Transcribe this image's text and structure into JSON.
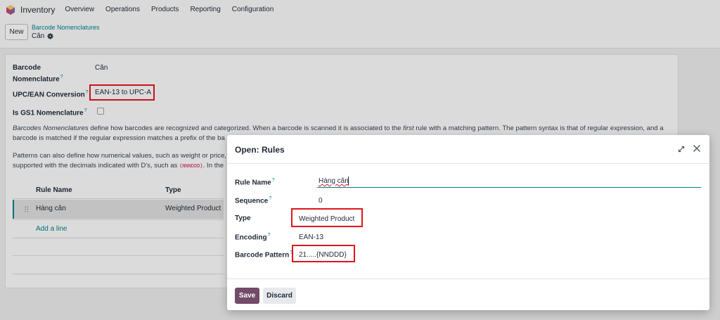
{
  "navbar": {
    "app_name": "Inventory",
    "menu": [
      "Overview",
      "Operations",
      "Products",
      "Reporting",
      "Configuration"
    ]
  },
  "control": {
    "new_label": "New",
    "breadcrumb": "Barcode Nomenclatures",
    "record_name": "Cân"
  },
  "form": {
    "nomenclature_label_1": "Barcode",
    "nomenclature_label_2": "Nomenclature",
    "nomenclature_value": "Cân",
    "upc_label": "UPC/EAN Conversion",
    "upc_value": "EAN-13 to UPC-A",
    "gs1_label": "Is GS1 Nomenclature",
    "tooltip_mark": "?",
    "para1": {
      "a": "Barcodes Nomenclatures",
      "b": " define how barcodes are recognized and categorized. When a barcode is scanned it is associated to the ",
      "c": "first",
      "d": " rule with a matching pattern. The pattern syntax is that of regular expression, and a",
      "line2": "barcode is matched if the regular expression matches a prefix of the ba"
    },
    "para2": {
      "line1": "Patterns can also define how numerical values, such as weight or price,",
      "line2a": "supported with the decimals indicated with D's, such as ",
      "line2code": "{NNNDDD}",
      "line2b": ". In the"
    },
    "table": {
      "col_rule_name": "Rule Name",
      "col_type": "Type",
      "rows": [
        {
          "rule_name": "Hàng cân",
          "type": "Weighted Product"
        }
      ],
      "add_line": "Add a line"
    }
  },
  "modal": {
    "title": "Open: Rules",
    "rule_name_label": "Rule Name",
    "rule_name_value": "Hàng cân",
    "sequence_label": "Sequence",
    "sequence_value": "0",
    "type_label": "Type",
    "type_value": "Weighted Product",
    "encoding_label": "Encoding",
    "encoding_value": "EAN-13",
    "pattern_label": "Barcode Pattern",
    "pattern_value": "21.....{NNDDD}",
    "save_label": "Save",
    "discard_label": "Discard"
  },
  "colors": {
    "accent_teal": "#017e84",
    "primary_purple": "#714b67",
    "highlight_red": "#e0151b"
  }
}
